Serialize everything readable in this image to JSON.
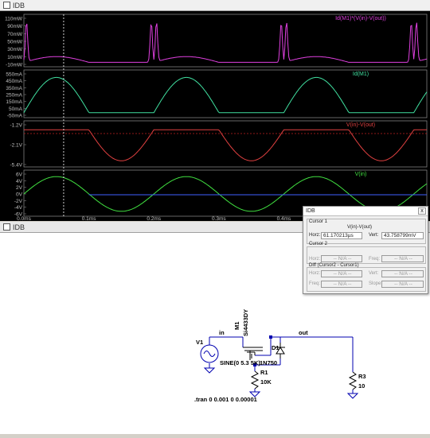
{
  "plot_window": {
    "title": "IDB",
    "panes": [
      {
        "trace": "Id(M1)*(V(in)-V(out))",
        "color": "#e040e0",
        "yticks": [
          "110mW",
          "90mW",
          "70mW",
          "50mW",
          "30mW",
          "10mW",
          "-10mW"
        ]
      },
      {
        "trace": "Id(M1)",
        "color": "#40e0a0",
        "yticks": [
          "550mA",
          "450mA",
          "350mA",
          "250mA",
          "150mA",
          "50mA",
          "-50mA"
        ]
      },
      {
        "trace": "V(in)-V(out)",
        "color": "#e04040",
        "yticks": [
          "-1.2V",
          "-2.1V",
          "-5.4V"
        ]
      },
      {
        "trace": "V(in)",
        "color": "#40e040",
        "yticks": [
          "6V",
          "4V",
          "2V",
          "0V",
          "-2V",
          "-4V",
          "-6V"
        ]
      }
    ],
    "xticks": [
      "0.0ms",
      "0.1ms",
      "0.2ms",
      "0.3ms",
      "0.4ms",
      "0.5ms"
    ]
  },
  "cursor_window": {
    "title": "IDB",
    "close": "x",
    "cursor1_label": "Cursor 1",
    "cursor1_trace": "V(in)-V(out)",
    "horz_label": "Horz:",
    "horz_value": "61.170213µs",
    "vert_label": "Vert:",
    "vert_value": "43.758799mV",
    "cursor2_label": "Cursor 2",
    "na": "-- N/A --",
    "diff_label": "Diff (Cursor2 - Cursor1)",
    "freq_label": "Freq:",
    "slope_label": "Slope:"
  },
  "schematic_window": {
    "title": "IDB",
    "labels": {
      "in": "in",
      "out": "out",
      "m1": "M1",
      "m1_model": "Si4433DY",
      "v1": "V1",
      "v1_value": "SINE(0 5.3 5K)",
      "d1": "D1",
      "d1_model": "1N750",
      "r1": "R1",
      "r1_value": "10K",
      "r3": "R3",
      "r3_value": "10",
      "tran": ".tran 0 0.001 0 0.00001"
    }
  }
}
